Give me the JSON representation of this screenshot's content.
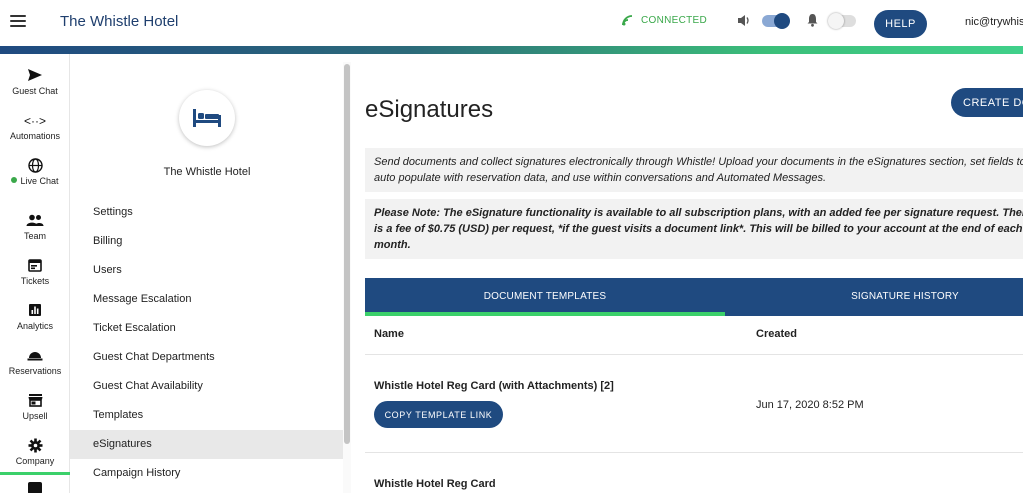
{
  "header": {
    "title": "The Whistle Hotel",
    "connection_status": "CONNECTED",
    "help_label": "HELP",
    "user_email": "nic@trywhistle.com",
    "accent_color": "#1f4a80",
    "connected_color": "#3aa84a"
  },
  "rail": {
    "items": [
      {
        "label": "Guest Chat",
        "icon": "send-icon"
      },
      {
        "label": "Automations",
        "icon": "code-arrows-icon"
      },
      {
        "label": "Live Chat",
        "icon": "globe-icon"
      },
      {
        "label": "Team",
        "icon": "people-icon"
      },
      {
        "label": "Tickets",
        "icon": "calendar-icon"
      },
      {
        "label": "Analytics",
        "icon": "bar-chart-icon"
      },
      {
        "label": "Reservations",
        "icon": "bell-service-icon"
      },
      {
        "label": "Upsell",
        "icon": "storefront-icon"
      },
      {
        "label": "Company",
        "icon": "gear-icon"
      }
    ],
    "active": "Company"
  },
  "settings_panel": {
    "hotel_name": "The Whistle Hotel",
    "avatar_icon": "bed-icon",
    "items": [
      "Settings",
      "Billing",
      "Users",
      "Message Escalation",
      "Ticket Escalation",
      "Guest Chat Departments",
      "Guest Chat Availability",
      "Templates",
      "eSignatures",
      "Campaign History"
    ],
    "active": "eSignatures"
  },
  "main": {
    "title": "eSignatures",
    "create_button": "CREATE DOCUMENT",
    "info_text": "Send documents and collect signatures electronically through Whistle! Upload your documents in the eSignatures section, set fields to auto populate with reservation data, and use within conversations and Automated Messages.",
    "note_text": "Please Note: The eSignature functionality is available to all subscription plans, with an added fee per signature request. There is a fee of $0.75 (USD) per request, *if the guest visits a document link*. This will be billed to your account at the end of each month.",
    "tabs": [
      {
        "label": "DOCUMENT TEMPLATES",
        "active": true
      },
      {
        "label": "SIGNATURE HISTORY",
        "active": false
      }
    ],
    "table": {
      "columns": [
        "Name",
        "Created"
      ],
      "rows": [
        {
          "name": "Whistle Hotel Reg Card (with Attachments) [2]",
          "created": "Jun 17, 2020 8:52 PM",
          "action": "COPY TEMPLATE LINK"
        },
        {
          "name": "Whistle Hotel Reg Card",
          "created": ""
        }
      ]
    }
  }
}
